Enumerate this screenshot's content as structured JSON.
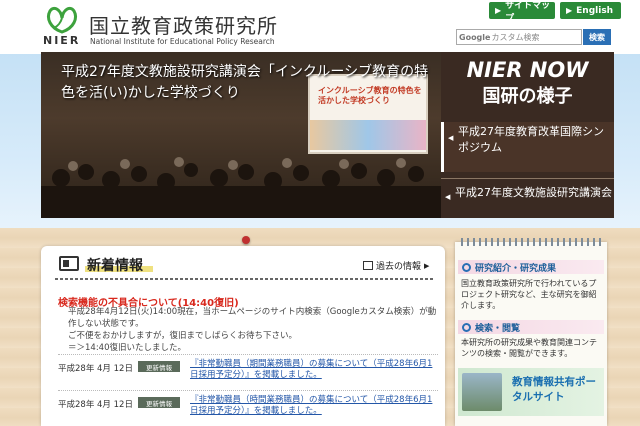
{
  "header": {
    "logo_abbr": "NIER",
    "org_name": "国立教育政策研究所",
    "org_name_en": "National Institute for Educational Policy Research",
    "sitemap_label": "サイトマップ",
    "english_label": "English",
    "search_placeholder": "カスタム検索",
    "search_brand": "Google",
    "search_button": "検索"
  },
  "banner": {
    "caption": "平成27年度文教施設研究講演会「インクルーシブ教育の特色を活(い)かした学校づくり",
    "screen_text": "インクルーシブ教育の特色を活かした学校づくり",
    "panel_title": "NIER NOW",
    "panel_subtitle": "国研の様子",
    "items": [
      "平成27年度教育改革国際シンポジウム",
      "平成27年度文教施設研究講演会"
    ]
  },
  "news": {
    "title": "新着情報",
    "archive_label": "過去の情報",
    "notice": {
      "heading": "検索機能の不具合について(14:40復旧)",
      "lines": [
        "平成28年4月12日(火)14:00現在，当ホームページのサイト内検索（Googleカスタム検索）が動作しない状態です。",
        "ご不便をおかけしますが，復旧までしばらくお待ち下さい。",
        "＝＞14:40復旧いたしました。"
      ]
    },
    "items": [
      {
        "date": "平成28年 4月 12日",
        "tag": "更新情報",
        "text": "『非常勤職員（期間業務職員）の募集について（平成28年6月1日採用予定分）』を掲載しました。"
      },
      {
        "date": "平成28年 4月 12日",
        "tag": "更新情報",
        "text": "『非常勤職員（時間業務職員）の募集について（平成28年6月1日採用予定分）』を掲載しました。"
      }
    ]
  },
  "sidebar": {
    "research_title": "研究紹介・研究成果",
    "research_text": "国立教育政策研究所で行われているプロジェクト研究など、主な研究を御紹介します。",
    "search_title": "検索・閲覧",
    "search_text": "本研究所の研究成果や教育関連コンテンツの検索・閲覧ができます。",
    "portal_title": "教育情報共有ポータルサイト"
  },
  "colors": {
    "accent_green": "#2a8a38",
    "search_blue": "#2a6fb5",
    "notice_red": "#d8281d",
    "link_blue": "#2457a8"
  }
}
